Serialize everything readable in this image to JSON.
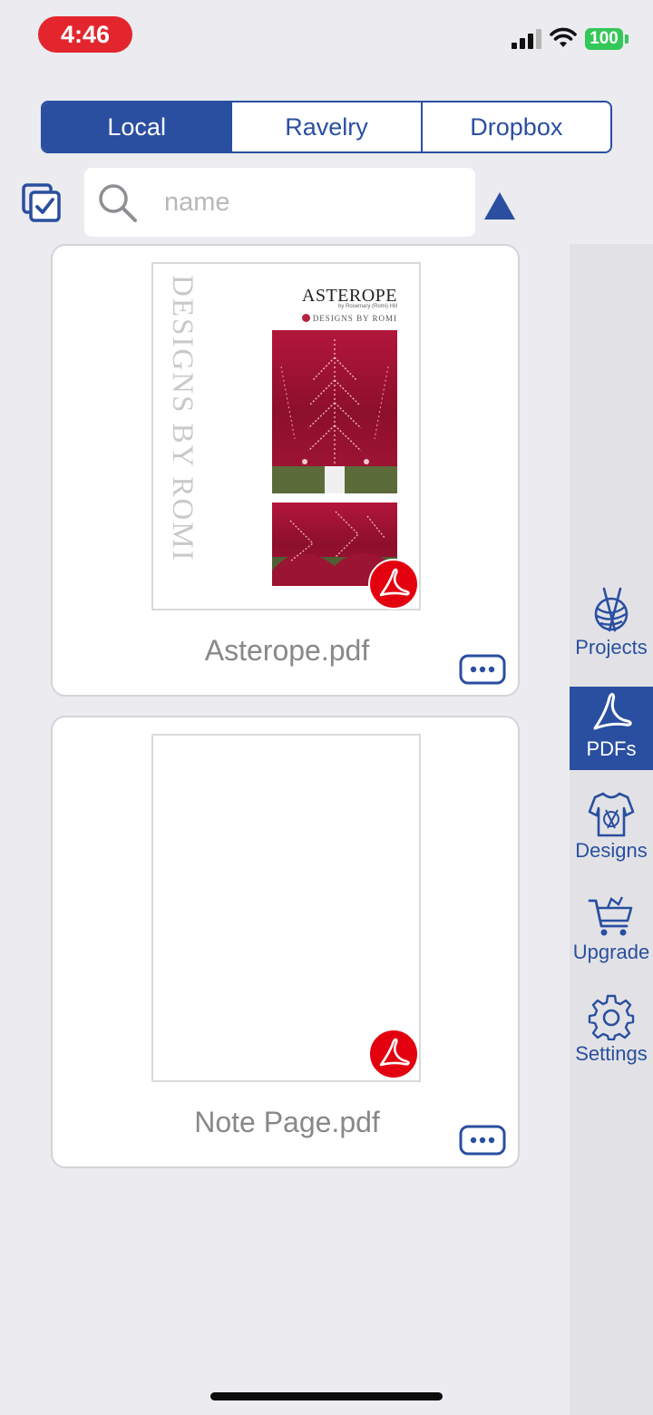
{
  "status_bar": {
    "time": "4:46",
    "battery": "100",
    "colors": {
      "time_pill": "#e3262d",
      "battery": "#34c759"
    }
  },
  "source_tabs": [
    {
      "label": "Local",
      "active": true
    },
    {
      "label": "Ravelry",
      "active": false
    },
    {
      "label": "Dropbox",
      "active": false
    }
  ],
  "toolbar": {
    "select_icon": "multi-select-checkbox-icon",
    "search_icon": "search-icon",
    "search_placeholder": "name",
    "search_value": "",
    "sort_icon": "triangle-up-icon"
  },
  "files": [
    {
      "name": "Asterope.pdf",
      "thumbnail": {
        "side_text": "DESIGNS BY ROMI",
        "title": "ASTEROPE",
        "author": "by Rosemary (Romi) Hill",
        "brand": "DESIGNS BY ROMI"
      },
      "badge_icon": "adobe-pdf-icon",
      "menu_icon": "more-icon"
    },
    {
      "name": "Note Page.pdf",
      "thumbnail": null,
      "badge_icon": "adobe-pdf-icon",
      "menu_icon": "more-icon"
    }
  ],
  "tabbar": [
    {
      "label": "Projects",
      "icon": "yarn-needles-icon",
      "active": false
    },
    {
      "label": "PDFs",
      "icon": "adobe-pdf-icon",
      "active": true
    },
    {
      "label": "Designs",
      "icon": "sweater-icon",
      "active": false
    },
    {
      "label": "Upgrade",
      "icon": "shopping-cart-icon",
      "active": false
    },
    {
      "label": "Settings",
      "icon": "gear-icon",
      "active": false
    }
  ],
  "theme": {
    "accent": "#2a4fa0",
    "background": "#ebebf0",
    "pdf_red": "#e3000f"
  }
}
